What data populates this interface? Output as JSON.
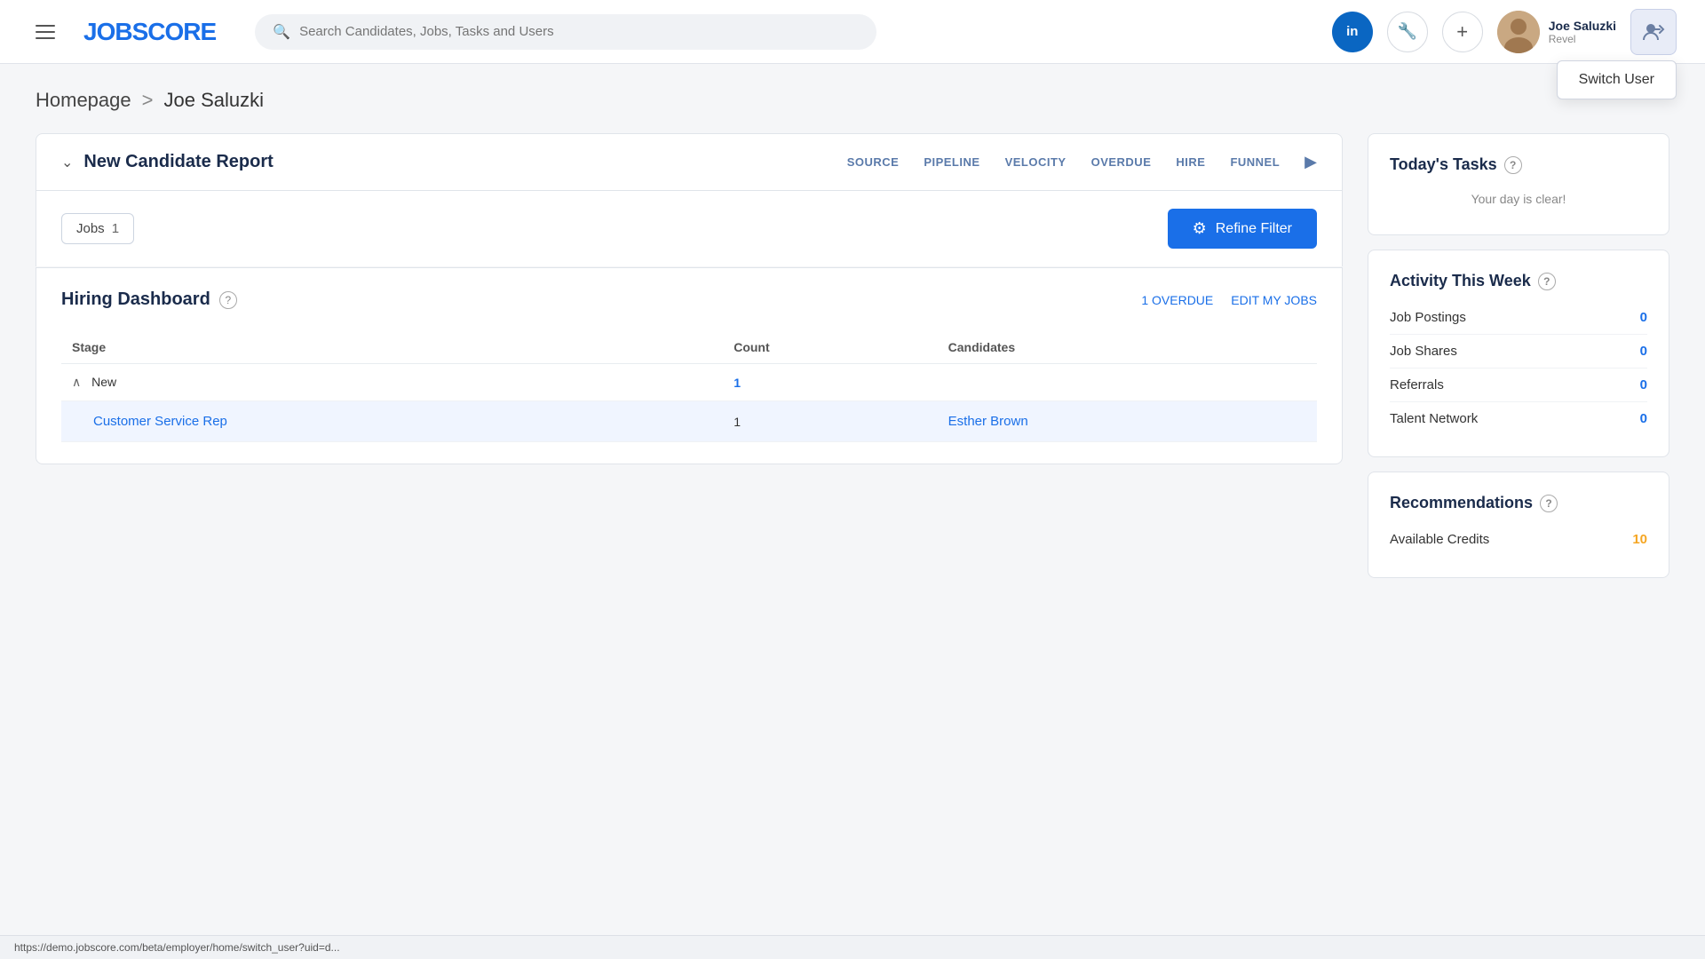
{
  "app": {
    "name": "JOBSCORE",
    "name_part1": "JOB",
    "name_part2": "SCORE"
  },
  "header": {
    "search_placeholder": "Search Candidates, Jobs, Tasks and Users",
    "user_name": "Joe Saluzki",
    "user_company": "Revel",
    "linkedin_icon": "in",
    "add_icon": "+",
    "wrench_icon": "🔧"
  },
  "breadcrumb": {
    "home": "Homepage",
    "separator": ">",
    "current": "Joe Saluzki"
  },
  "candidate_report": {
    "title": "New Candidate Report",
    "nav_items": [
      "SOURCE",
      "PIPELINE",
      "VELOCITY",
      "OVERDUE",
      "HIRE",
      "FUNNEL"
    ]
  },
  "filter_row": {
    "jobs_label": "Jobs",
    "jobs_count": "1",
    "refine_button": "Refine Filter"
  },
  "hiring_dashboard": {
    "title": "Hiring Dashboard",
    "overdue_link": "1 OVERDUE",
    "edit_jobs_link": "EDIT MY JOBS",
    "table_headers": [
      "Stage",
      "Count",
      "Candidates"
    ],
    "stage_label": "New",
    "stage_count": "1",
    "job_name": "Customer Service Rep",
    "job_count": "1",
    "candidate_name": "Esther Brown"
  },
  "todays_tasks": {
    "title": "Today's Tasks",
    "empty_message": "Your day is clear!"
  },
  "activity_this_week": {
    "title": "Activity This Week",
    "items": [
      {
        "label": "Job Postings",
        "count": "0"
      },
      {
        "label": "Job Shares",
        "count": "0"
      },
      {
        "label": "Referrals",
        "count": "0"
      },
      {
        "label": "Talent Network",
        "count": "0"
      }
    ]
  },
  "recommendations": {
    "title": "Recommendations",
    "available_credits_label": "Available Credits",
    "available_credits_count": "10"
  },
  "switch_user": {
    "label": "Switch User"
  },
  "status_bar": {
    "url": "https://demo.jobscore.com/beta/employer/home/switch_user?uid=d..."
  },
  "colors": {
    "primary": "#1a6fe8",
    "logo_accent": "#1a6fe8",
    "dark_navy": "#1a2b4b"
  }
}
